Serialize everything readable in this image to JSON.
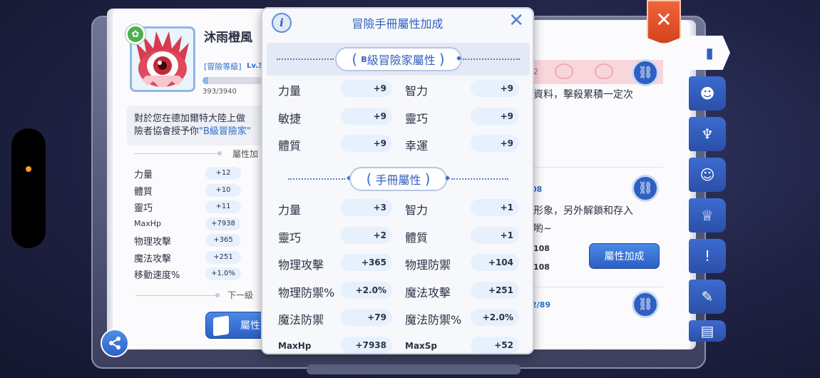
{
  "profile": {
    "name": "沐雨橙風",
    "rank": "[冒險等級]",
    "level": "Lv.3",
    "exp_text": "393/3940",
    "exp_progress": 0.1,
    "desc_line1": "對於您在德加爾特大陸上做",
    "desc_line2_prefix": "險者協會授予你",
    "desc_line2_highlight": "\"B級冒險家\"",
    "attr_heading": "屬性加",
    "next_level": "下一級",
    "button_label": "屬性"
  },
  "left_stats": [
    {
      "name": "力量",
      "value": "+12"
    },
    {
      "name": "體質",
      "value": "+10"
    },
    {
      "name": "靈巧",
      "value": "+11"
    },
    {
      "name": "MaxHp",
      "value": "+7938"
    },
    {
      "name": "物理攻擊",
      "value": "+365"
    },
    {
      "name": "魔法攻擊",
      "value": "+251"
    },
    {
      "name": "移動速度%",
      "value": "+1.0%"
    }
  ],
  "right_page": {
    "card1_num": "2",
    "card1_text": "資料，擊殺累積一定次",
    "card2_num": "08",
    "card2_text1": "形象，另外解鎖和存入",
    "card2_text2": "喲~",
    "card2_val1": "108",
    "card2_val2": "108",
    "attr_button": "屬性加成",
    "card3_num": "2/89"
  },
  "modal": {
    "title": "冒險手冊屬性加成",
    "section1": {
      "prefix": "B",
      "title": "級冒險家屬性",
      "rows": [
        [
          {
            "name": "力量",
            "value": "+9"
          },
          {
            "name": "智力",
            "value": "+9"
          }
        ],
        [
          {
            "name": "敏捷",
            "value": "+9"
          },
          {
            "name": "靈巧",
            "value": "+9"
          }
        ],
        [
          {
            "name": "體質",
            "value": "+9"
          },
          {
            "name": "幸運",
            "value": "+9"
          }
        ]
      ]
    },
    "section2": {
      "title": "手冊屬性",
      "rows": [
        [
          {
            "name": "力量",
            "value": "+3"
          },
          {
            "name": "智力",
            "value": "+1"
          }
        ],
        [
          {
            "name": "靈巧",
            "value": "+2"
          },
          {
            "name": "體質",
            "value": "+1"
          }
        ],
        [
          {
            "name": "物理攻擊",
            "value": "+365"
          },
          {
            "name": "物理防禦",
            "value": "+104"
          }
        ],
        [
          {
            "name": "物理防禦%",
            "value": "+2.0%"
          },
          {
            "name": "魔法攻擊",
            "value": "+251"
          }
        ],
        [
          {
            "name": "魔法防禦",
            "value": "+79"
          },
          {
            "name": "魔法防禦%",
            "value": "+2.0%"
          }
        ],
        [
          {
            "name": "MaxHp",
            "value": "+7938"
          },
          {
            "name": "MaxSp",
            "value": "+52"
          }
        ]
      ]
    }
  },
  "colors": {
    "accent": "#2f5fc1",
    "close_ribbon": "#e2522a",
    "stat_pill": "#e6f1fd"
  }
}
